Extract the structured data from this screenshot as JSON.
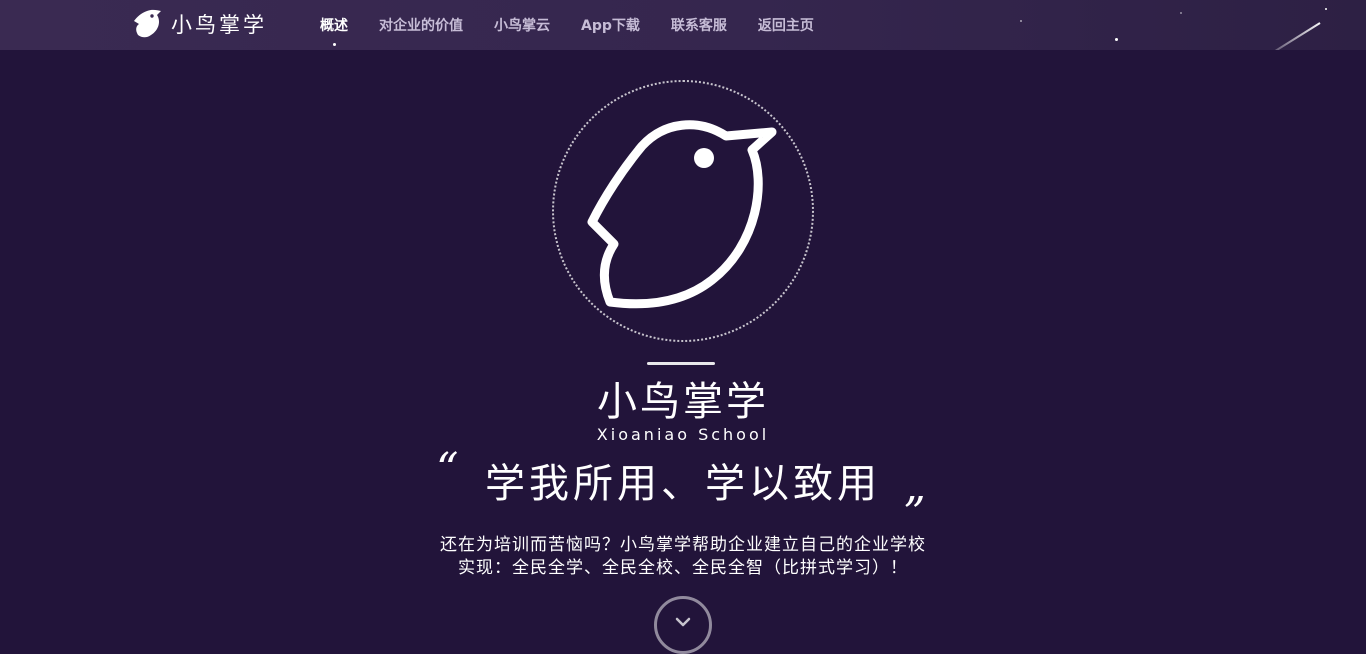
{
  "header": {
    "brand_name": "小鸟掌学",
    "nav": [
      {
        "label": "概述",
        "active": true
      },
      {
        "label": "对企业的价值",
        "active": false
      },
      {
        "label": "小鸟掌云",
        "active": false
      },
      {
        "label": "App下载",
        "active": false
      },
      {
        "label": "联系客服",
        "active": false
      },
      {
        "label": "返回主页",
        "active": false
      }
    ]
  },
  "hero": {
    "title": "小鸟掌学",
    "subtitle": "Xioaniao School",
    "quote_open": "“",
    "quote_close": "”",
    "slogan": "学我所用、学以致用",
    "desc_line1": "还在为培训而苦恼吗？小鸟掌学帮助企业建立自己的企业学校",
    "desc_line2": "实现：全民全学、全民全校、全民全智（比拼式学习）！",
    "scroll_icon": "chevron-down-icon"
  },
  "colors": {
    "background": "#22143a",
    "topbar": "#3a2a52",
    "nav_text": "#c6bcd6",
    "nav_active": "#ffffff"
  }
}
